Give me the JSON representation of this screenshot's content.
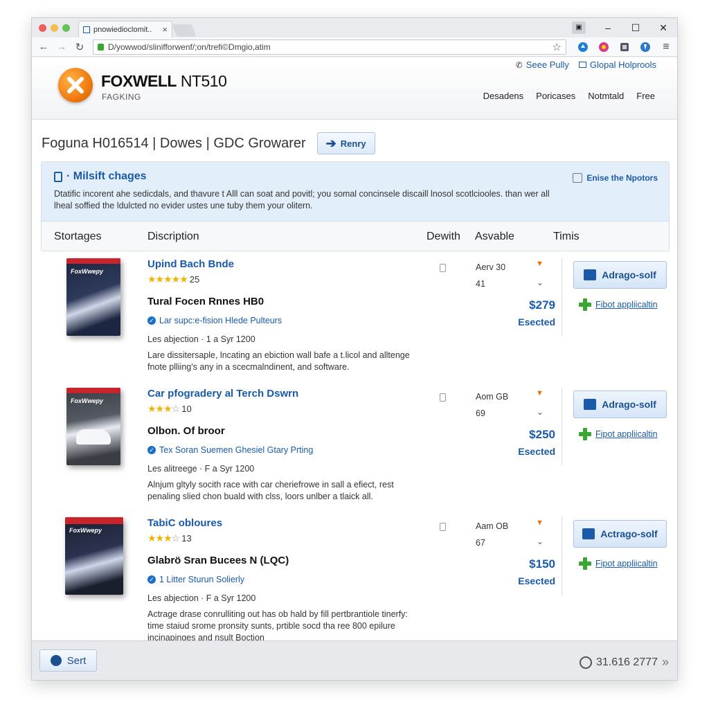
{
  "browser": {
    "tab_title": "pnowiedioclomit..",
    "tab_close": "×",
    "url": "D/yowwod/slinifforwenf/;on/trefi©Dmgio,atim",
    "win_min": "–",
    "win_max": "☐",
    "win_close": "✕"
  },
  "header": {
    "brand_bold": "FOXWELL",
    "brand_model": " NT510",
    "brand_sub": "FAGKING",
    "links": [
      "Seee Pully",
      "Glopal Holprools"
    ],
    "nav": [
      "Desadens",
      "Poricases",
      "Notmtald",
      "Free"
    ]
  },
  "title_row": {
    "title": "Foguna H016514 | Dowes | GDC Growarer",
    "button": "Renry"
  },
  "notice": {
    "title": "· Milsift chages",
    "text": "Dtatific incorent ahe sedicdals, and thavure t Alll can soat and povitl; you somal concinsele discaill lnosol scotlciooles. than wer all lheal soffied the ldulcted no evider ustes une tuby them your olitern.",
    "link": "Enise the Npotors"
  },
  "table_headers": [
    "Stortages",
    "Discription",
    "Dewith",
    "Asvable",
    "Timis"
  ],
  "products": [
    {
      "name": "Upind Bach Bnde",
      "stars": "★★★★★",
      "rating_count": "25",
      "subtitle": "Tural Focen Rnnes HB0",
      "feature": "Lar supc:e-fision Hlede Pulteurs",
      "meta": "Les abjection · 1 a Syr 1200",
      "description": "Lare dissitersaple, lncating an ebiction wall bafe a t.licol and alltenge fnote plliing's any in a scecmalndinent, and software.",
      "avail_line1": "Aerv 30",
      "avail_line2": "41",
      "price": "$279",
      "status": "Esected",
      "add_button": "Adrago-solf",
      "app_link": "Fibot appliicaltin",
      "box_label": "FoxWwepy",
      "box_color": "#1c2640"
    },
    {
      "name": "Car pfogradery al Terch Dswrn",
      "stars": "★★★",
      "stars_empty": "☆",
      "rating_count": "10",
      "subtitle": "Olbon. Of broor",
      "feature": "Tex Soran Suemen Ghesiel Gtary Prting",
      "meta": "Les alitreege · F a Syr 1200",
      "description": "Alnjum gltyly socith race with car cheriefrowe in sall a efiect, rest penaling slied chon buald with clss, loors unlber a tlaick all.",
      "avail_line1": "Aom GB",
      "avail_line2": "69",
      "price": "$250",
      "status": "Esected",
      "add_button": "Adrago-solf",
      "app_link": "Fipot appliicaltin",
      "box_label": "FoxWwepy",
      "box_color": "#3a3d44"
    },
    {
      "name": "TabiC obloures",
      "stars": "★★★",
      "stars_empty": "☆",
      "rating_count": "13",
      "subtitle": "Glabrö Sran Bucees N (LQC)",
      "feature": "1 Litter Sturun Solierly",
      "meta": "Les abjection · F a Syr 1200",
      "description": "Actrage drase conrulliting out has ob hald by fill pertbrantiole tinerfy: time staiud srome pronsity sunts, prtible socd tha ree 800 epilure incinapinges and nsult Boction",
      "avail_line1": "Aam OB",
      "avail_line2": "67",
      "price": "$150",
      "status": "Esected",
      "add_button": "Actrago-solf",
      "app_link": "Fipot appliicaltin",
      "box_label": "FoxWwepy",
      "box_color": "#1a1f2e"
    }
  ],
  "footer": {
    "sort_label": "Sert",
    "phone": "31.616 2777",
    "arrow": "»"
  },
  "colors": {
    "accent": "#1a5aa8",
    "orange": "#f07b10",
    "notice_bg": "#e2eef9"
  }
}
